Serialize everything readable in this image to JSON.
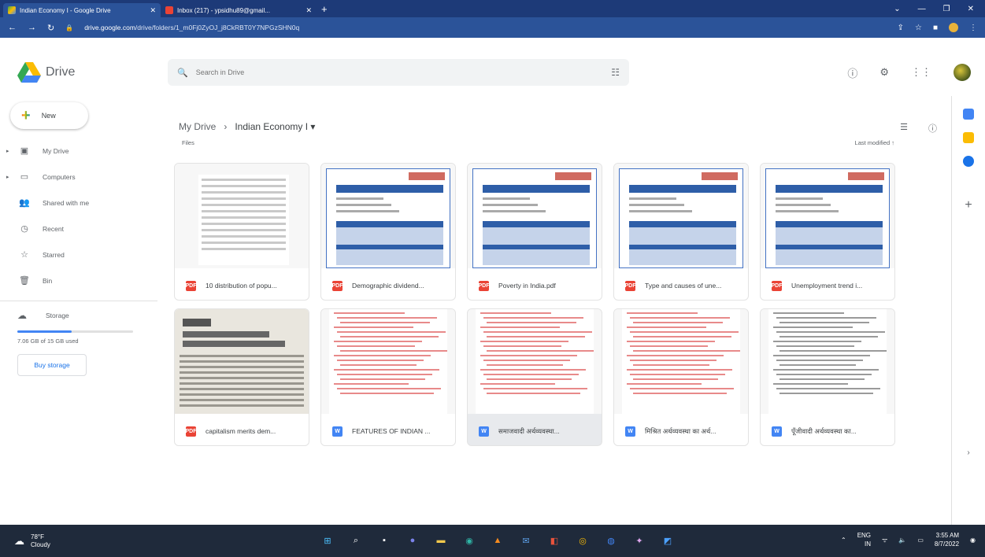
{
  "browser": {
    "tabs": [
      {
        "label": "Indian Economy I - Google Drive",
        "active": true
      },
      {
        "label": "Inbox (217) - ypsidhu89@gmail...",
        "active": false
      }
    ],
    "url_host": "drive.google.com",
    "url_path": "/drive/folders/1_m0Fj0ZyOJ_j8CkRBT0Y7NPGzSHN0q"
  },
  "header": {
    "app_name": "Drive",
    "search_placeholder": "Search in Drive"
  },
  "sidebar": {
    "new_label": "New",
    "items": [
      {
        "label": "My Drive",
        "icon": "my-drive-icon",
        "glyph": "▣",
        "has_caret": true
      },
      {
        "label": "Computers",
        "icon": "computers-icon",
        "glyph": "▭",
        "has_caret": true
      },
      {
        "label": "Shared with me",
        "icon": "shared-icon",
        "glyph": "👥",
        "has_caret": false
      },
      {
        "label": "Recent",
        "icon": "recent-icon",
        "glyph": "◷",
        "has_caret": false
      },
      {
        "label": "Starred",
        "icon": "starred-icon",
        "glyph": "☆",
        "has_caret": false
      },
      {
        "label": "Bin",
        "icon": "bin-icon",
        "glyph": "🗑",
        "has_caret": false
      }
    ],
    "storage_label": "Storage",
    "storage_used": "7.06 GB of 15 GB used",
    "storage_fraction": 0.47,
    "buy_label": "Buy storage"
  },
  "main": {
    "breadcrumb_root": "My Drive",
    "breadcrumb_current": "Indian Economy I",
    "section_label": "Files",
    "sort_label": "Last modified",
    "files": [
      {
        "name": "10 distribution of popu...",
        "type": "pdf",
        "thumb": "table"
      },
      {
        "name": "Demographic dividend...",
        "type": "pdf",
        "thumb": "form"
      },
      {
        "name": "Poverty in India.pdf",
        "type": "pdf",
        "thumb": "form"
      },
      {
        "name": "Type and causes of une...",
        "type": "pdf",
        "thumb": "form"
      },
      {
        "name": "Unemployment trend i...",
        "type": "pdf",
        "thumb": "form"
      },
      {
        "name": "capitalism merits dem...",
        "type": "pdf",
        "thumb": "photo"
      },
      {
        "name": "FEATURES OF INDIAN ...",
        "type": "doc",
        "thumb": "red"
      },
      {
        "name": "समाजवादी अर्थव्यवस्था...",
        "type": "doc",
        "thumb": "red"
      },
      {
        "name": "मिश्रित अर्थव्यवस्था का अर्थ...",
        "type": "doc",
        "thumb": "red"
      },
      {
        "name": "पूँजीवादी अर्थव्यवस्था का...",
        "type": "doc",
        "thumb": "black"
      }
    ]
  },
  "taskbar": {
    "temp": "78°F",
    "condition": "Cloudy",
    "lang": "ENG",
    "region": "IN",
    "time": "3:55 AM",
    "date": "8/7/2022"
  }
}
